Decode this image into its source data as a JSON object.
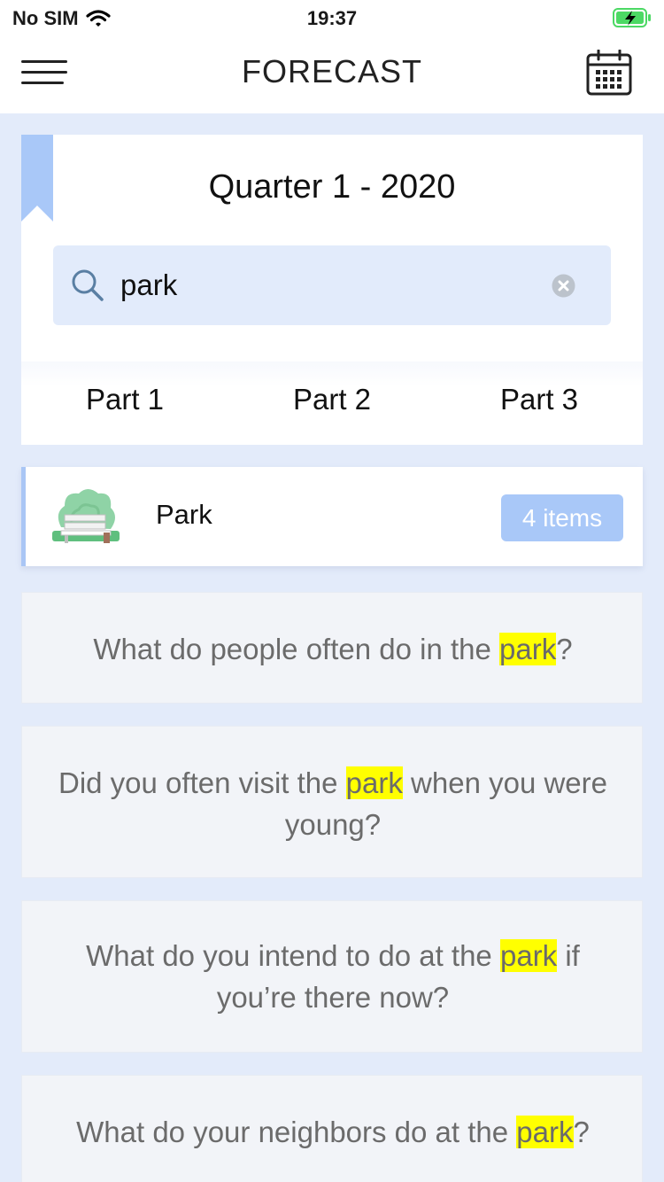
{
  "status_bar": {
    "carrier": "No SIM",
    "time": "19:37"
  },
  "nav": {
    "title": "FORECAST"
  },
  "header": {
    "quarter_title": "Quarter 1 - 2020",
    "search": {
      "value": "park",
      "placeholder": ""
    },
    "parts": [
      "Part 1",
      "Part 2",
      "Part 3"
    ]
  },
  "category": {
    "label": "Park",
    "count": "4 items"
  },
  "questions": [
    {
      "before": "What do people often do in the ",
      "keyword": "park",
      "after": "?"
    },
    {
      "before": "Did you often visit the ",
      "keyword": "park",
      "after": " when you were young?"
    },
    {
      "before": "What do you intend to do at the ",
      "keyword": "park",
      "after": " if you’re there now?"
    },
    {
      "before": "What do your neighbors do at the ",
      "keyword": "park",
      "after": "?"
    }
  ],
  "colors": {
    "background": "#e3ebfa",
    "accent": "#a9c8f8",
    "search_bg": "#e2ebfb",
    "highlight": "#ffff00",
    "question_text": "#6b6b6b"
  },
  "icons": [
    "wifi-icon",
    "battery-icon",
    "menu-icon",
    "calendar-icon",
    "bookmark-icon",
    "search-icon",
    "clear-icon",
    "park-icon"
  ]
}
